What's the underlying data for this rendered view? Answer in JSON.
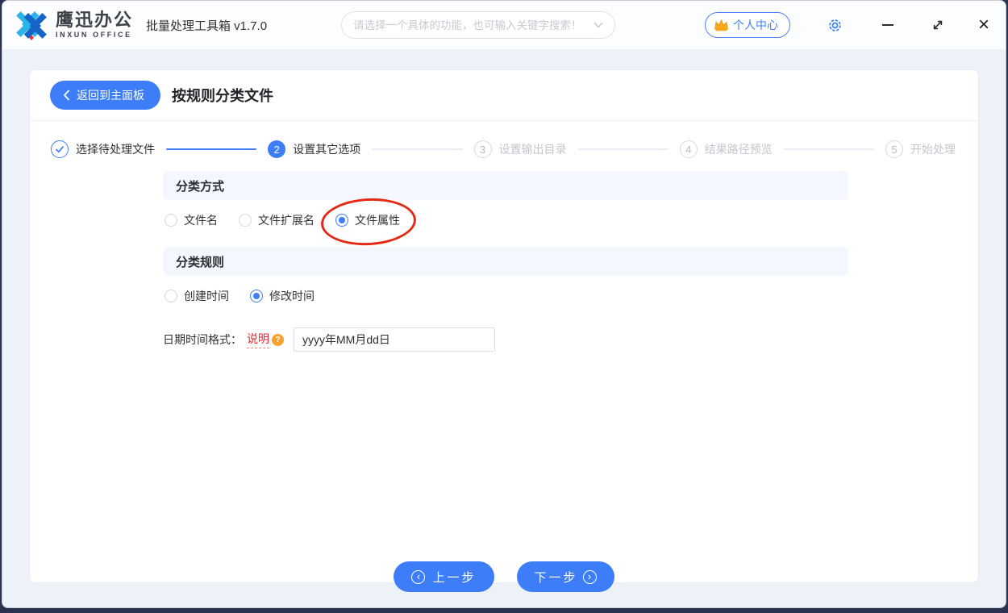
{
  "titlebar": {
    "logo_title": "鹰迅办公",
    "logo_subtitle": "INXUN OFFICE",
    "app_title": "批量处理工具箱 v1.7.0",
    "search": {
      "placeholder": "请选择一个具体的功能，也可输入关键字搜索！"
    },
    "user_center_label": "个人中心",
    "close_glyph": "×"
  },
  "header": {
    "back_label": "返回到主面板",
    "page_title": "按规则分类文件"
  },
  "stepper": {
    "steps": [
      {
        "marker": "✓",
        "label": "选择待处理文件",
        "state": "done"
      },
      {
        "marker": "2",
        "label": "设置其它选项",
        "state": "active"
      },
      {
        "marker": "3",
        "label": "设置输出目录",
        "state": "pending"
      },
      {
        "marker": "4",
        "label": "结果路径预览",
        "state": "pending"
      },
      {
        "marker": "5",
        "label": "开始处理",
        "state": "pending"
      }
    ]
  },
  "form": {
    "classification_method": {
      "title": "分类方式",
      "options": [
        {
          "label": "文件名",
          "selected": false
        },
        {
          "label": "文件扩展名",
          "selected": false
        },
        {
          "label": "文件属性",
          "selected": true,
          "annotation": "red-circle"
        }
      ]
    },
    "classification_rule": {
      "title": "分类规则",
      "options": [
        {
          "label": "创建时间",
          "selected": false
        },
        {
          "label": "修改时间",
          "selected": true
        }
      ]
    },
    "datetime_format": {
      "label": "日期时间格式：",
      "help_label": "说明",
      "help_badge": "?",
      "value": "yyyy年MM月dd日"
    }
  },
  "footer": {
    "prev_label": "上一步",
    "prev_icon": "‹",
    "next_label": "下一步",
    "next_icon": "›"
  },
  "colors": {
    "accent_blue": "#3d7df7",
    "annotation_red": "#e42a17",
    "help_orange": "#f9a22b",
    "section_bg": "#f4f8fe"
  }
}
